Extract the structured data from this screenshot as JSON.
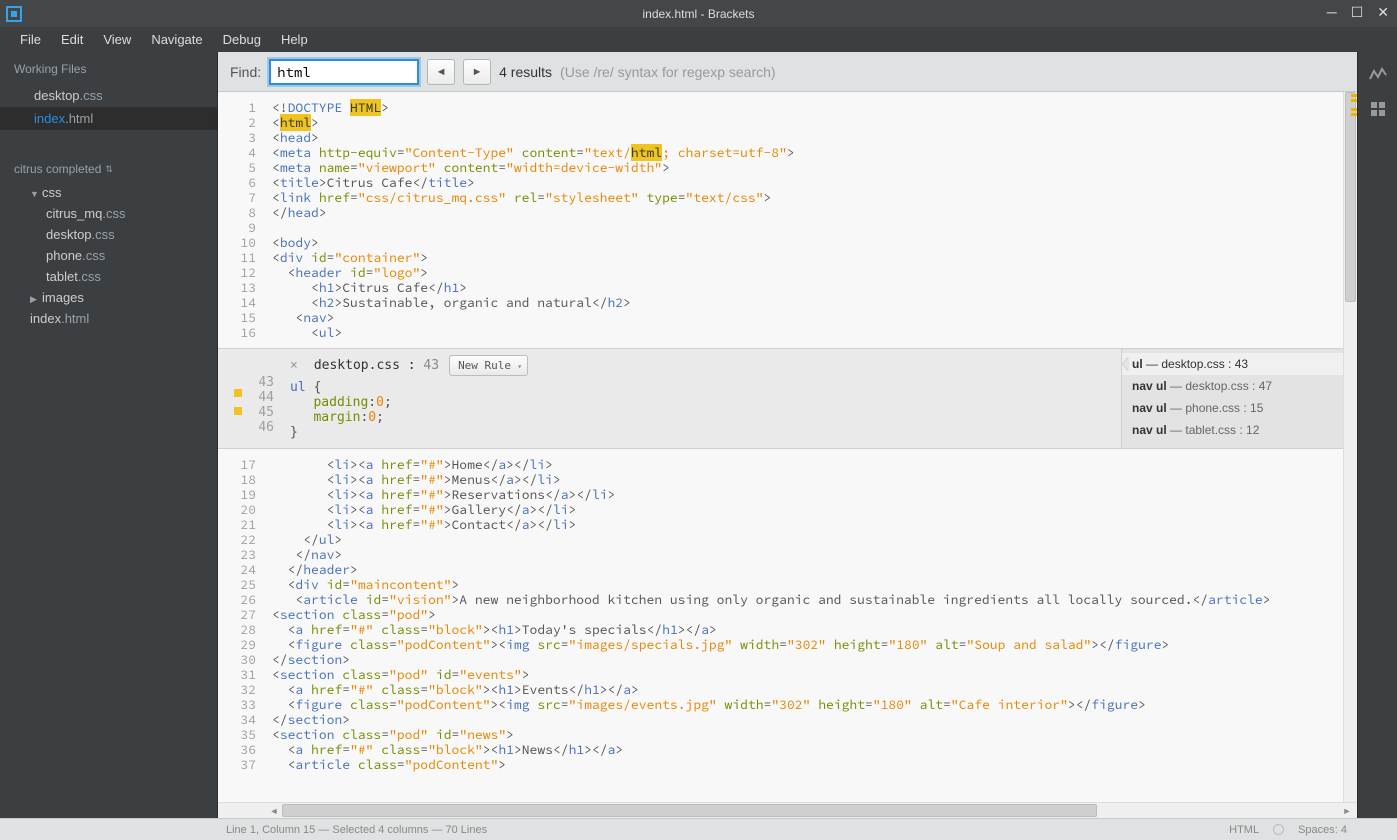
{
  "window": {
    "title": "index.html - Brackets"
  },
  "menus": [
    "File",
    "Edit",
    "View",
    "Navigate",
    "Debug",
    "Help"
  ],
  "sidebar": {
    "working_files_label": "Working Files",
    "working_files": [
      {
        "base": "desktop",
        "ext": ".css",
        "active": false
      },
      {
        "base": "index",
        "ext": ".html",
        "active": true
      }
    ],
    "project_name": "citrus completed",
    "tree": [
      {
        "label": "css",
        "kind": "folder",
        "open": true,
        "depth": 0
      },
      {
        "base": "citrus_mq",
        "ext": ".css",
        "kind": "file",
        "depth": 1
      },
      {
        "base": "desktop",
        "ext": ".css",
        "kind": "file",
        "depth": 1
      },
      {
        "base": "phone",
        "ext": ".css",
        "kind": "file",
        "depth": 1
      },
      {
        "base": "tablet",
        "ext": ".css",
        "kind": "file",
        "depth": 1
      },
      {
        "label": "images",
        "kind": "folder",
        "open": false,
        "depth": 0
      },
      {
        "base": "index",
        "ext": ".html",
        "kind": "file",
        "depth": 0
      }
    ]
  },
  "find": {
    "label": "Find:",
    "value": "html",
    "results": "4 results",
    "hint": "(Use /re/ syntax for regexp search)"
  },
  "editor": {
    "lines_top": [
      1,
      2,
      3,
      4,
      5,
      6,
      7,
      8,
      9,
      10,
      11,
      12,
      13,
      14,
      15,
      16
    ],
    "lines_bottom": [
      17,
      18,
      19,
      20,
      21,
      22,
      23,
      24,
      25,
      26,
      27,
      28,
      29,
      30,
      31,
      32,
      33,
      34,
      35,
      36,
      37
    ]
  },
  "inline": {
    "title_file": "desktop.css",
    "title_line": "43",
    "new_rule": "New Rule",
    "gutter": [
      43,
      44,
      45,
      46
    ],
    "rules": [
      {
        "sel": "ul",
        "rest": " — desktop.css : 43",
        "active": true
      },
      {
        "sel": "nav ul",
        "rest": " — desktop.css : 47"
      },
      {
        "sel": "nav ul",
        "rest": " — phone.css : 15"
      },
      {
        "sel": "nav ul",
        "rest": " — tablet.css : 12"
      }
    ],
    "code": {
      "sel": "ul",
      "p1": "padding",
      "p2": "margin",
      "v": "0"
    }
  },
  "status": {
    "left": "Line 1, Column 15 — Selected 4 columns — 70 Lines",
    "lang": "HTML",
    "spaces": "Spaces: 4"
  }
}
